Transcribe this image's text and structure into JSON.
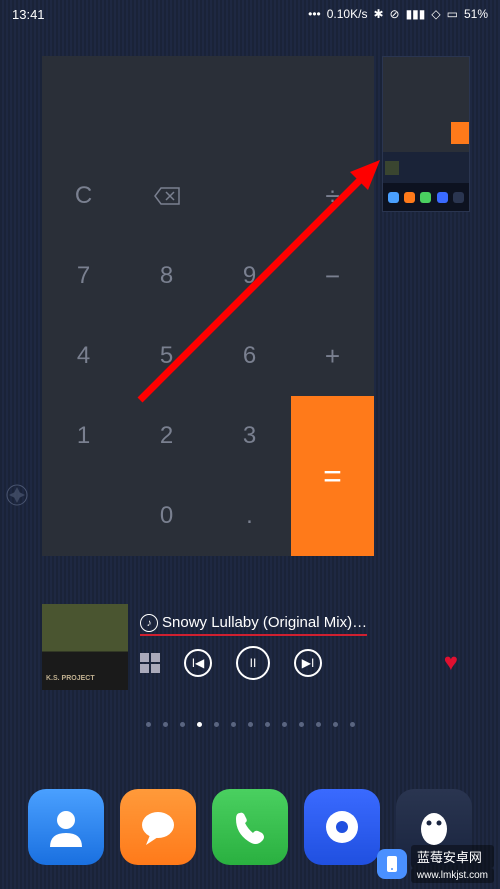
{
  "status": {
    "time": "13:41",
    "net_speed": "0.10K/s",
    "battery_pct": "51%"
  },
  "calculator": {
    "clear": "C",
    "divide": "÷",
    "minus": "−",
    "plus": "+",
    "equals": "=",
    "n7": "7",
    "n8": "8",
    "n9": "9",
    "n4": "4",
    "n5": "5",
    "n6": "6",
    "n1": "1",
    "n2": "2",
    "n3": "3",
    "n0": "0",
    "dot": "."
  },
  "music": {
    "title": "Snowy Lullaby (Original Mix)…",
    "artist_tag": "K.S. PROJECT",
    "liked": true
  },
  "pages": {
    "count": 13,
    "active_index": 3
  },
  "colors": {
    "accent_orange": "#ff7a1a",
    "heart_red": "#e01030",
    "underline_red": "#d02030"
  },
  "watermark": {
    "site": "蓝莓安卓网",
    "url": "www.lmkjst.com"
  }
}
